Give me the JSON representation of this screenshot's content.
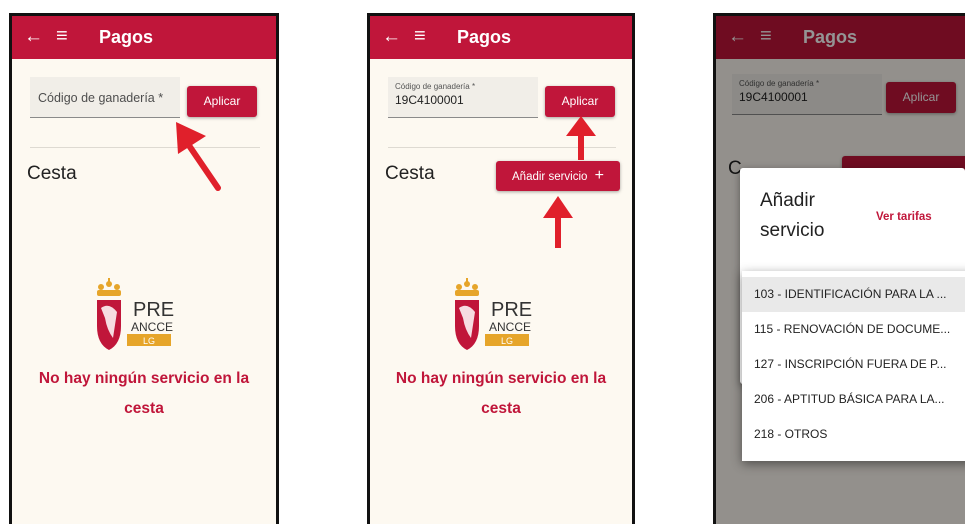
{
  "app": {
    "title": "Pagos",
    "back_icon": "arrow-left-icon",
    "menu_icon": "hamburger-menu-icon",
    "accent_color": "#c0163a",
    "background_color": "#fdf9f1"
  },
  "screens": [
    {
      "code_field": {
        "placeholder": "Código de ganadería *"
      },
      "apply_label": "Aplicar",
      "cart_title": "Cesta",
      "logo": {
        "text_pre": "PRE",
        "text_ancce": "ANCCE",
        "text_lg": "LG"
      },
      "empty_message_line1": "No hay ningún servicio en la",
      "empty_message_line2": "cesta"
    },
    {
      "code_field": {
        "label": "Código de ganadería *",
        "value": "19C4100001"
      },
      "apply_label": "Aplicar",
      "cart_title": "Cesta",
      "add_service_label": "Añadir servicio",
      "add_service_icon": "plus-icon",
      "logo": {
        "text_pre": "PRE",
        "text_ancce": "ANCCE",
        "text_lg": "LG"
      },
      "empty_message_line1": "No hay ningún servicio en la",
      "empty_message_line2": "cesta"
    },
    {
      "code_field": {
        "label": "Código de ganadería *",
        "value": "19C4100001"
      },
      "apply_label": "Aplicar",
      "cart_title_partial": "C",
      "dialog": {
        "title_line1": "Añadir",
        "title_line2": "servicio",
        "rates_link": "Ver tarifas"
      },
      "service_options": [
        "103 - IDENTIFICACIÓN PARA LA ...",
        "115 - RENOVACIÓN DE DOCUME...",
        "127 - INSCRIPCIÓN FUERA DE P...",
        "206 - APTITUD BÁSICA PARA LA...",
        "218 - OTROS"
      ]
    }
  ]
}
